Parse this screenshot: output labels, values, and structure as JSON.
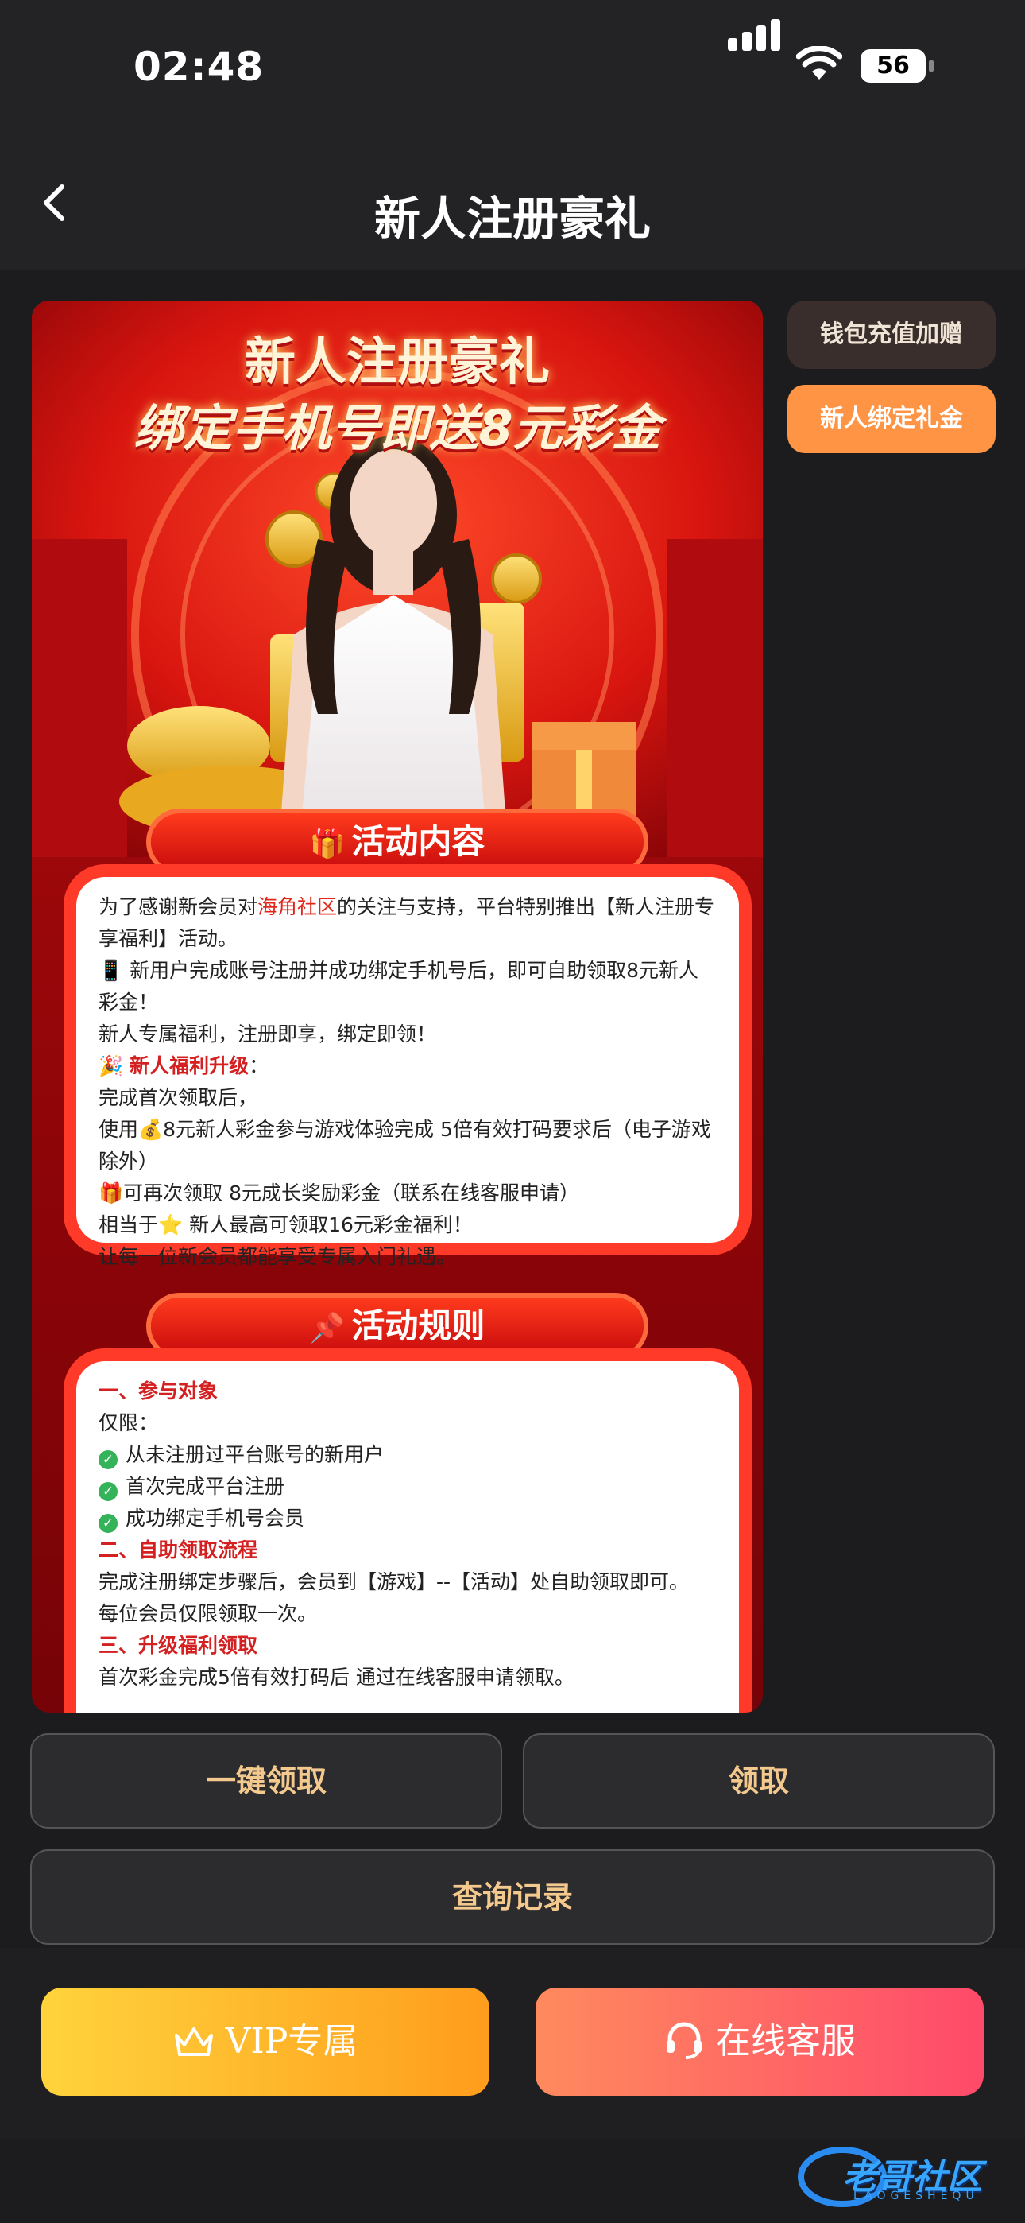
{
  "status_bar": {
    "time": "02:48",
    "battery": "56"
  },
  "header": {
    "title": "新人注册豪礼"
  },
  "side_tabs": [
    {
      "label": "钱包充值加赠"
    },
    {
      "label": "新人绑定礼金"
    }
  ],
  "banner": {
    "title_line1": "新人注册豪礼",
    "title_line2": "绑定手机号即送8元彩金"
  },
  "activity_content": {
    "heading": "活动内容",
    "heading_icon": "gift-icon",
    "p1_before": "为了感谢新会员对",
    "p1_highlight": "海角社区",
    "p1_after": "的关注与支持，平台特别推出【新人注册专享福利】活动。",
    "p2": "📱 新用户完成账号注册并成功绑定手机号后，即可自助领取8元新人彩金！",
    "p3": "新人专属福利，注册即享，绑定即领！",
    "p4_icon": "🎉",
    "p4_label": "新人福利升级",
    "p4_colon": "：",
    "p5": "完成首次领取后，",
    "p6": "使用💰8元新人彩金参与游戏体验完成 5倍有效打码要求后（电子游戏除外）",
    "p7": "🎁可再次领取 8元成长奖励彩金（联系在线客服申请）",
    "p8": "相当于⭐ 新人最高可领取16元彩金福利！",
    "p9": "让每一位新会员都能享受专属入门礼遇。"
  },
  "activity_rules": {
    "heading": "活动规则",
    "heading_icon": "pin-icon",
    "s1_title": "一、参与对象",
    "s1_only": "仅限：",
    "s1_items": [
      "从未注册过平台账号的新用户",
      "首次完成平台注册",
      "成功绑定手机号会员"
    ],
    "s2_title": "二、自助领取流程",
    "s2_text1": "完成注册绑定步骤后，会员到【游戏】--【活动】处自助领取即可。",
    "s2_text2": "每位会员仅限领取一次。",
    "s3_title": "三、升级福利领取",
    "s3_text1": "首次彩金完成5倍有效打码后 通过在线客服申请领取。"
  },
  "buttons": {
    "claim_all": "一键领取",
    "claim": "领取",
    "history": "查询记录"
  },
  "bottom": {
    "vip": "VIP专属",
    "service": "在线客服"
  },
  "watermark": {
    "text": "老哥社区",
    "sub": "LAOGESHEQU"
  },
  "colors": {
    "accent_orange": "#ff9544",
    "gold_text": "#f4c98e",
    "highlight_red": "#e0251a"
  }
}
